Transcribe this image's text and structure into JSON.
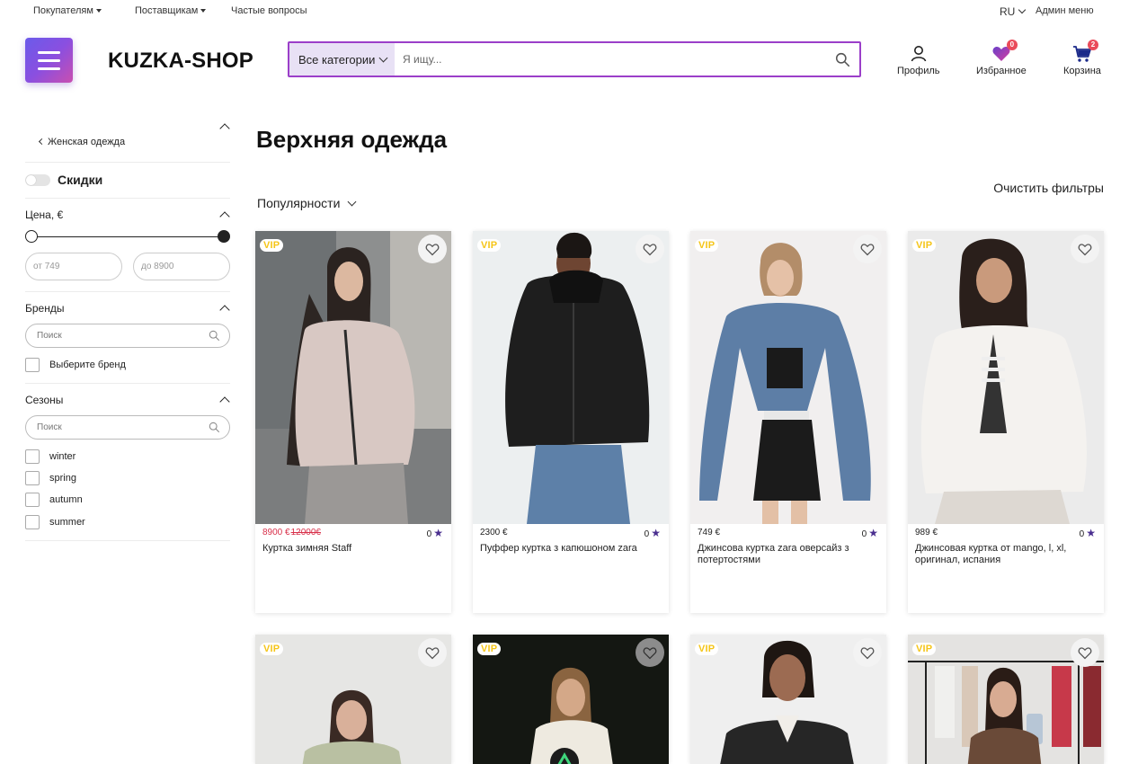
{
  "topbar": {
    "buyers": "Покупателям",
    "suppliers": "Поставщикам",
    "faq": "Частые вопросы",
    "lang": "RU",
    "admin": "Админ меню"
  },
  "header": {
    "logo": "KUZKA-SHOP",
    "search_category": "Все категории",
    "search_placeholder": "Я ищу...",
    "profile": "Профиль",
    "favorites": "Избранное",
    "favorites_count": "0",
    "cart": "Корзина",
    "cart_count": "2"
  },
  "sidebar": {
    "back_link": "Женская одежда",
    "discounts": "Скидки",
    "price_title": "Цена, €",
    "price_from_placeholder": "от 749",
    "price_to_placeholder": "до 8900",
    "brands_title": "Бренды",
    "brands_search_placeholder": "Поиск",
    "brands_option": "Выберите бренд",
    "seasons_title": "Сезоны",
    "seasons_search_placeholder": "Поиск",
    "seasons": [
      "winter",
      "spring",
      "autumn",
      "summer"
    ]
  },
  "main": {
    "title": "Верхняя одежда",
    "sort_label": "Популярности",
    "clear_filters": "Очистить фильтры"
  },
  "products": [
    {
      "vip": "VIP",
      "price": "8900 €",
      "old_price": "12000€",
      "on_sale": true,
      "rating": "0",
      "name": "Куртка зимняя Staff"
    },
    {
      "vip": "VIP",
      "price": "2300 €",
      "old_price": "",
      "on_sale": false,
      "rating": "0",
      "name": "Пуффер куртка з капюшоном zara"
    },
    {
      "vip": "VIP",
      "price": "749 €",
      "old_price": "",
      "on_sale": false,
      "rating": "0",
      "name": "Джинсова куртка zara оверсайз з потертостями"
    },
    {
      "vip": "VIP",
      "price": "989 €",
      "old_price": "",
      "on_sale": false,
      "rating": "0",
      "name": "Джинсовая куртка от mango, l, xl, оригинал, испания"
    },
    {
      "vip": "VIP"
    },
    {
      "vip": "VIP"
    },
    {
      "vip": "VIP"
    },
    {
      "vip": "VIP"
    }
  ],
  "colors": {
    "accent": "#9b3fc9",
    "category_bg": "#e8e1f5",
    "badge": "#ea4b5a",
    "sale": "#d8304a",
    "vip": "#f5c518",
    "star": "#4a2f8f"
  }
}
